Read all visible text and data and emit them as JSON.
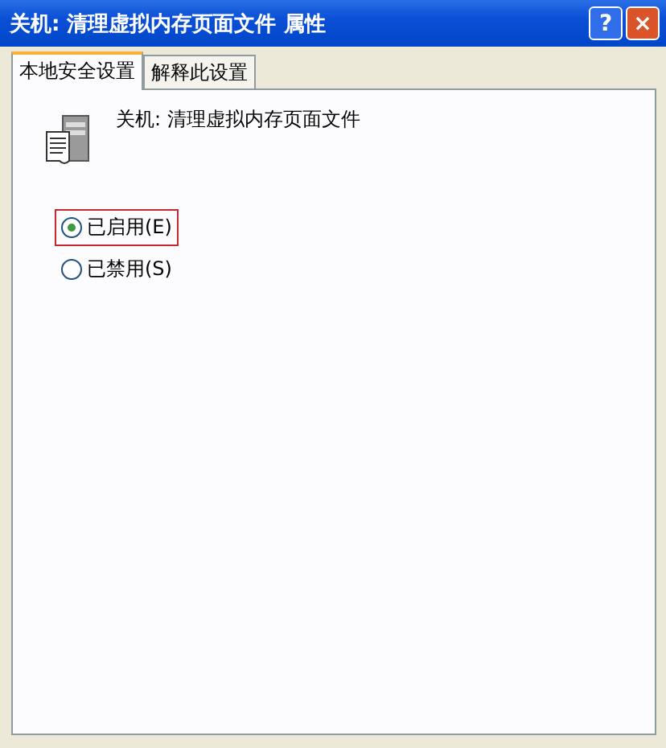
{
  "window": {
    "title": "关机: 清理虚拟内存页面文件 属性",
    "buttons": [
      {
        "kind": "help",
        "label": "?"
      },
      {
        "kind": "close",
        "label": "×"
      }
    ]
  },
  "tabs": [
    {
      "label": "本地安全设置",
      "selected": true
    },
    {
      "label": "解释此设置",
      "selected": false
    }
  ],
  "policy": {
    "name": "关机: 清理虚拟内存页面文件"
  },
  "options": [
    {
      "label": "已启用(E)",
      "selected": true,
      "highlighted": true
    },
    {
      "label": "已禁用(S)",
      "selected": false,
      "highlighted": false
    }
  ]
}
